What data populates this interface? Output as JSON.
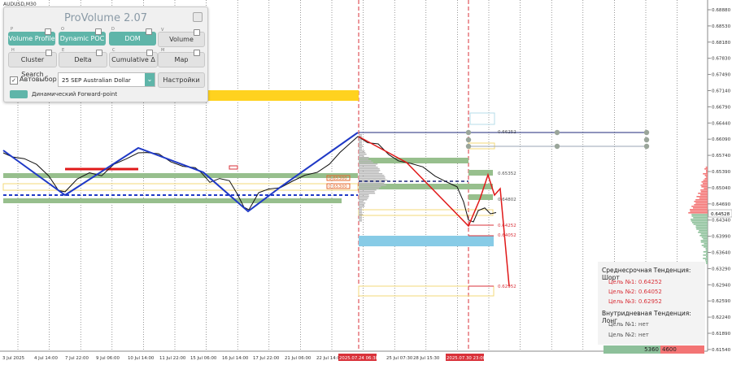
{
  "symbol": "AUDUSD,M30",
  "price_axis": [
    "0.68880",
    "0.68530",
    "0.68180",
    "0.67830",
    "0.67490",
    "0.67140",
    "0.66790",
    "0.66440",
    "0.66090",
    "0.65740",
    "0.65390",
    "0.65040",
    "0.64690",
    "0.64340",
    "0.63990",
    "0.63640",
    "0.63290",
    "0.62940",
    "0.62590",
    "0.62240",
    "0.61890",
    "0.61540"
  ],
  "current_price": "0.64528",
  "time_axis": [
    "3 Jul 2025",
    "4 Jul 14:00",
    "7 Jul 22:00",
    "9 Jul 06:00",
    "10 Jul 14:00",
    "11 Jul 22:00",
    "15 Jul 06:00",
    "16 Jul 14:00",
    "17 Jul 22:00",
    "21 Jul 06:00",
    "22 Jul 14:00",
    "2025.07.24 06:30",
    "25 Jul 07:30",
    "28 Jul 15:30",
    "2025.07.30 23:00"
  ],
  "chart_labels": {
    "level_1": "0.66252",
    "level_2": "0.65352",
    "level_3": "0.64802",
    "target_1": "0.64252",
    "target_2": "0.64052",
    "target_3": "0.62952",
    "poc_1": "0.65300",
    "poc_2": "0.65300"
  },
  "panel": {
    "title": "ProVolume 2.07",
    "buttons": [
      {
        "label": "Volume Profile",
        "hotkey": "P",
        "state": "on"
      },
      {
        "label": "Dynamic POC",
        "hotkey": "O",
        "state": "on"
      },
      {
        "label": "DOM",
        "hotkey": "D",
        "state": "on"
      },
      {
        "label": "Volume",
        "hotkey": "V",
        "state": "off"
      },
      {
        "label": "Cluster Search",
        "hotkey": "H",
        "state": "off"
      },
      {
        "label": "Delta",
        "hotkey": "E",
        "state": "off"
      },
      {
        "label": "Cumulative Δ",
        "hotkey": "C",
        "state": "off"
      },
      {
        "label": "Map",
        "hotkey": "M",
        "state": "off"
      }
    ],
    "auto_select_label": "Автовыбор",
    "instrument": "25 SEP Australian Dollar",
    "settings_label": "Настройки",
    "forward_point_label": "Динамический Forward-point"
  },
  "info_box": {
    "mid_trend": "Среднесрочная Тенденция: Шорт",
    "target_1": "Цель №1: 0.64252",
    "target_2": "Цель №2: 0.64052",
    "target_3": "Цель №3: 0.62952",
    "intraday_trend": "Внутридневная Тенденция: Лонг",
    "intraday_target_1": "Цель №1: нет",
    "intraday_target_2": "Цель №2: нет"
  },
  "volume_bar": {
    "sell": "5360",
    "buy": "4600"
  },
  "colors": {
    "accent": "#5fb5a9",
    "target_red": "#d9323a",
    "zone_yellow": "#ffd21f",
    "zone_blue": "#87cbe6",
    "zone_green": "#97bf8d",
    "wave_blue": "#1f39c6"
  }
}
